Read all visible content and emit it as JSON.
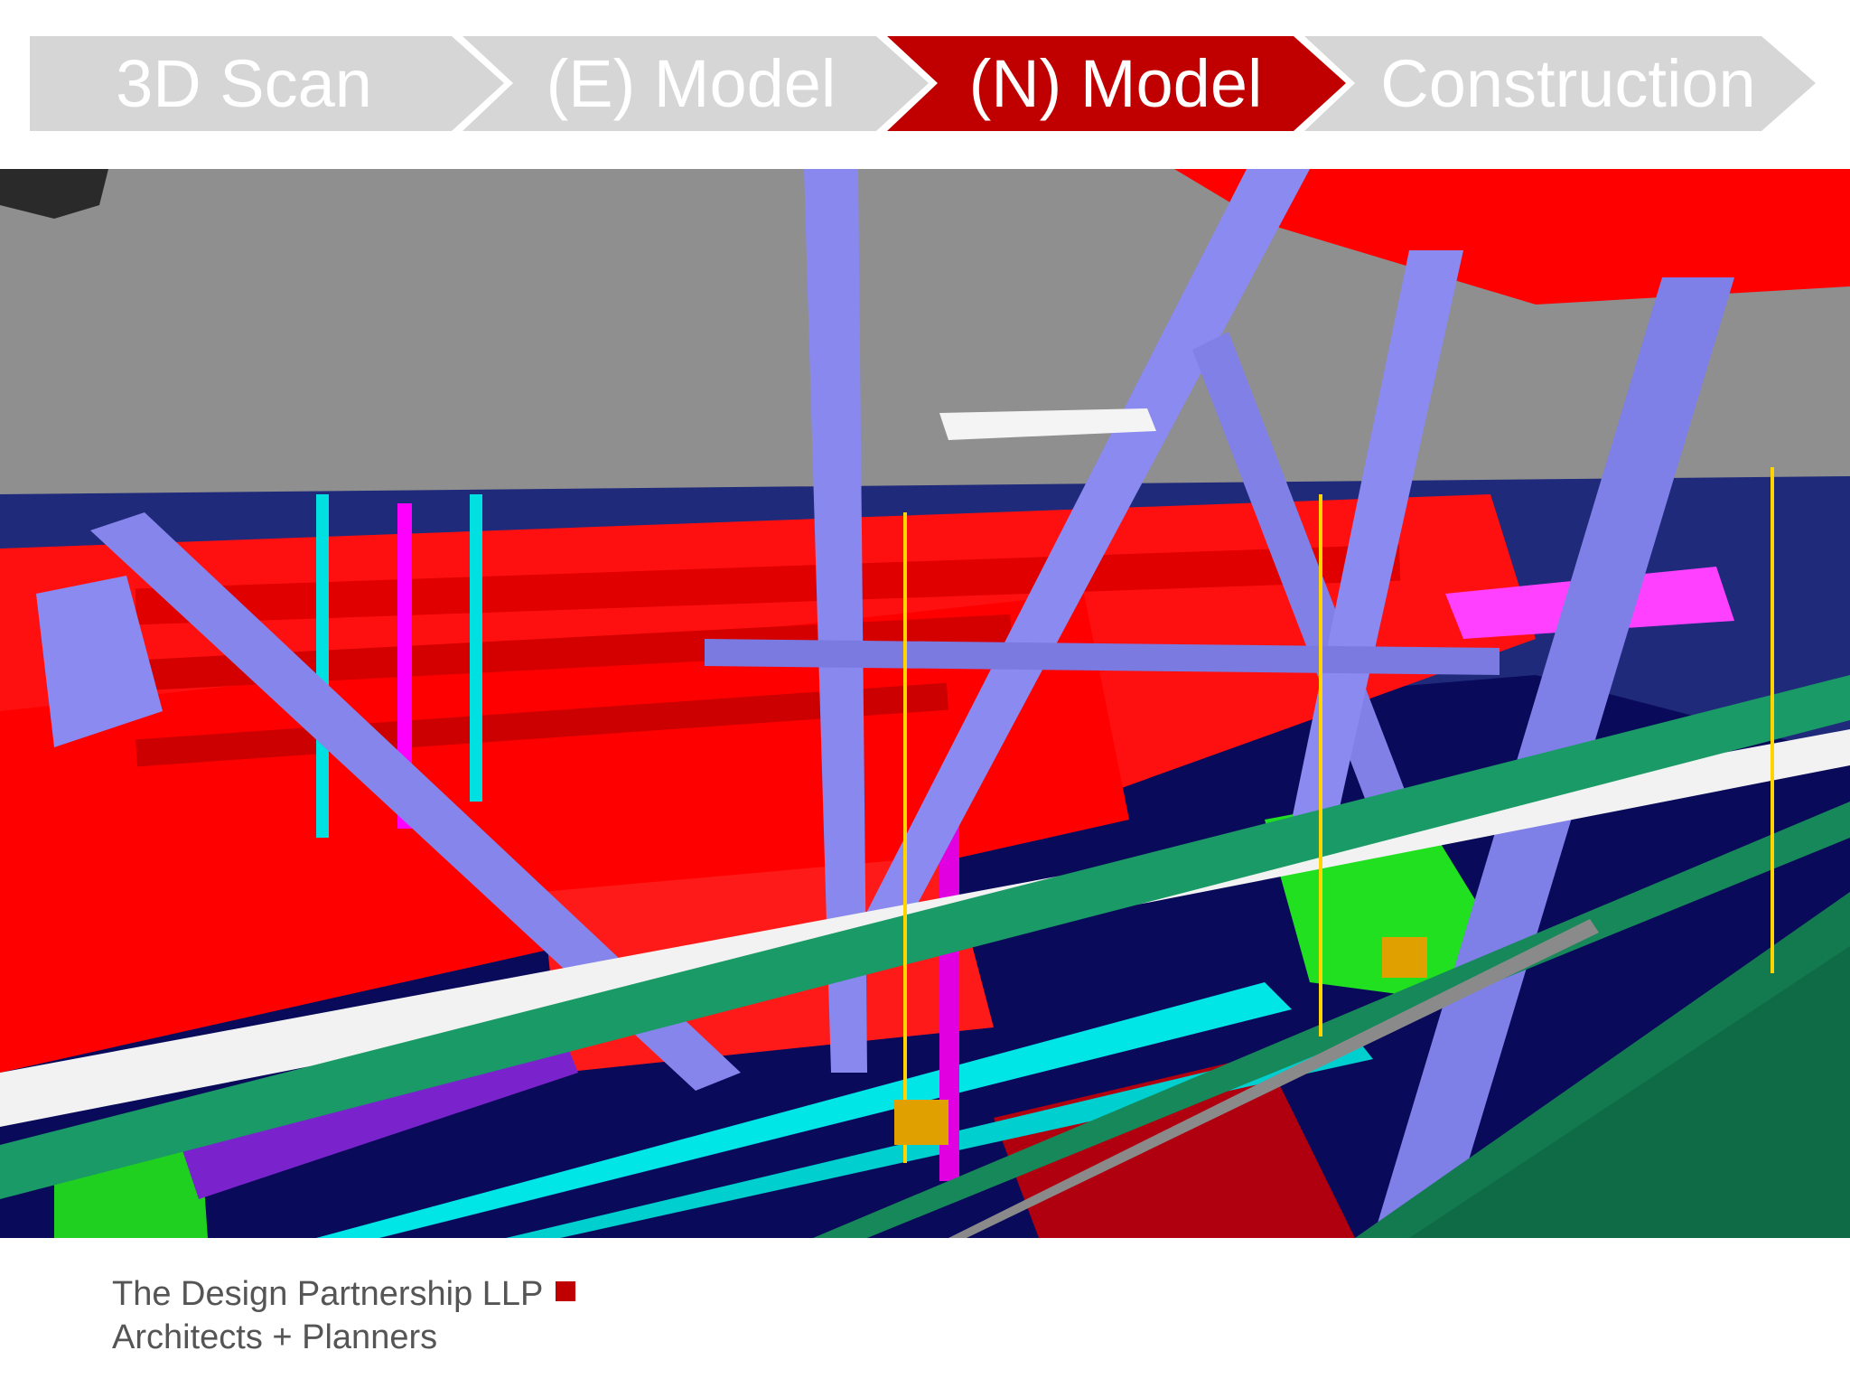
{
  "process_steps": [
    {
      "label": "3D Scan",
      "state": "inactive"
    },
    {
      "label": "(E) Model",
      "state": "inactive"
    },
    {
      "label": "(N) Model",
      "state": "active"
    },
    {
      "label": "Construction",
      "state": "inactive"
    }
  ],
  "colors": {
    "step_inactive": "#d6d6d6",
    "step_active": "#c00000",
    "brand_mark": "#c00000",
    "footer_text": "#555555"
  },
  "footer": {
    "company": "The Design Partnership LLP",
    "tagline": "Architects + Planners"
  }
}
